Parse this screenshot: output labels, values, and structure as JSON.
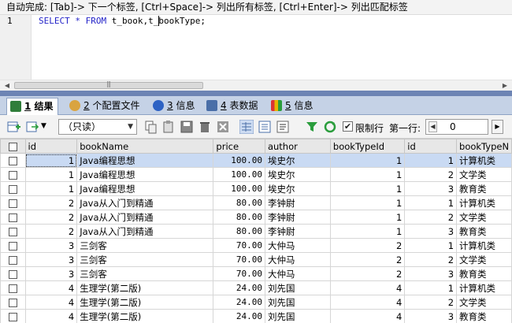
{
  "editor": {
    "hint": "自动完成: [Tab]-> 下一个标签, [Ctrl+Space]-> 列出所有标签, [Ctrl+Enter]-> 列出匹配标签",
    "line_number": "1",
    "sql_keyword_select": "SELECT",
    "sql_star": "*",
    "sql_keyword_from": "FROM",
    "sql_rest": "t_book,t_bookType;"
  },
  "result_tabs": [
    {
      "num": "1",
      "label": "结果",
      "icon": "table-results-icon",
      "active": true
    },
    {
      "num": "2",
      "label": "个配置文件",
      "icon": "profile-icon",
      "active": false
    },
    {
      "num": "3",
      "label": "信息",
      "icon": "info-icon",
      "active": false
    },
    {
      "num": "4",
      "label": "表数据",
      "icon": "table-data-icon",
      "active": false
    },
    {
      "num": "5",
      "label": "信息",
      "icon": "info-colored-icon",
      "active": false
    }
  ],
  "toolbar": {
    "mode_select_value": "（只读）",
    "limit_rows_label": "限制行",
    "limit_rows_checked": true,
    "first_row_label": "第一行:",
    "first_row_value": "0",
    "icons": [
      "insert-row-icon",
      "export-icon",
      "copy-row-icon",
      "paste-icon",
      "save-icon",
      "delete-icon",
      "delete-all-icon",
      "grid-view-icon",
      "form-view-icon",
      "text-view-icon",
      "filter-icon",
      "refresh-icon"
    ]
  },
  "grid": {
    "columns": [
      "id",
      "bookName",
      "price",
      "author",
      "bookTypeId",
      "id",
      "bookTypeN"
    ],
    "rows": [
      [
        "1",
        "Java编程思想",
        "100.00",
        "埃史尔",
        "1",
        "1",
        "计算机类"
      ],
      [
        "1",
        "Java编程思想",
        "100.00",
        "埃史尔",
        "1",
        "2",
        "文学类"
      ],
      [
        "1",
        "Java编程思想",
        "100.00",
        "埃史尔",
        "1",
        "3",
        "教育类"
      ],
      [
        "2",
        "Java从入门到精通",
        "80.00",
        "李钟尉",
        "1",
        "1",
        "计算机类"
      ],
      [
        "2",
        "Java从入门到精通",
        "80.00",
        "李钟尉",
        "1",
        "2",
        "文学类"
      ],
      [
        "2",
        "Java从入门到精通",
        "80.00",
        "李钟尉",
        "1",
        "3",
        "教育类"
      ],
      [
        "3",
        "三剑客",
        "70.00",
        "大仲马",
        "2",
        "1",
        "计算机类"
      ],
      [
        "3",
        "三剑客",
        "70.00",
        "大仲马",
        "2",
        "2",
        "文学类"
      ],
      [
        "3",
        "三剑客",
        "70.00",
        "大仲马",
        "2",
        "3",
        "教育类"
      ],
      [
        "4",
        "生理学(第二版)",
        "24.00",
        "刘先国",
        "4",
        "1",
        "计算机类"
      ],
      [
        "4",
        "生理学(第二版)",
        "24.00",
        "刘先国",
        "4",
        "2",
        "文学类"
      ],
      [
        "4",
        "生理学(第二版)",
        "24.00",
        "刘先国",
        "4",
        "3",
        "教育类"
      ]
    ],
    "selected_row": 0
  }
}
